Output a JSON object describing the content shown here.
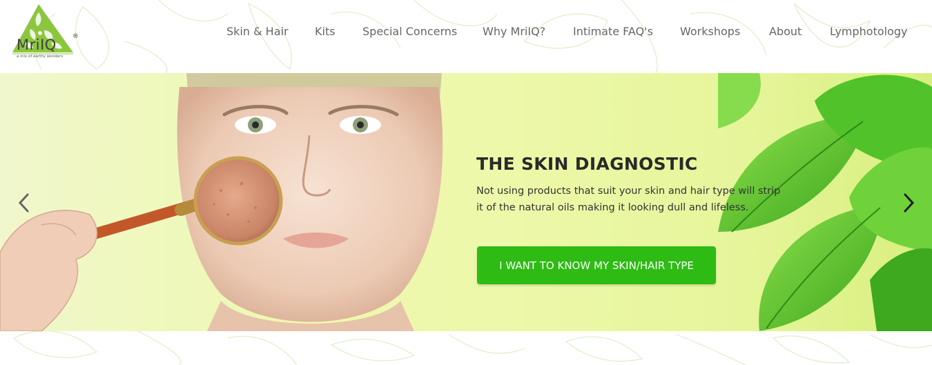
{
  "brand": {
    "name": "MriIQ",
    "registered": "®",
    "tagline": "a mix of earthy wonders",
    "color": "#8cc63f"
  },
  "nav": {
    "items": [
      {
        "label": "Skin & Hair"
      },
      {
        "label": "Kits"
      },
      {
        "label": "Special Concerns"
      },
      {
        "label": "Why MriIQ?"
      },
      {
        "label": "Intimate FAQ's"
      },
      {
        "label": "Workshops"
      },
      {
        "label": "About"
      },
      {
        "label": "Lymphotology"
      }
    ]
  },
  "hero": {
    "title": "THE SKIN DIAGNOSTIC",
    "description": "Not using products that suit your skin and hair type will strip it of the natural oils making it looking dull and lifeless.",
    "cta_label": "I WANT TO KNOW MY SKIN/HAIR TYPE",
    "cta_color": "#2dbb14",
    "prev_icon": "chevron-left-icon",
    "next_icon": "chevron-right-icon"
  }
}
